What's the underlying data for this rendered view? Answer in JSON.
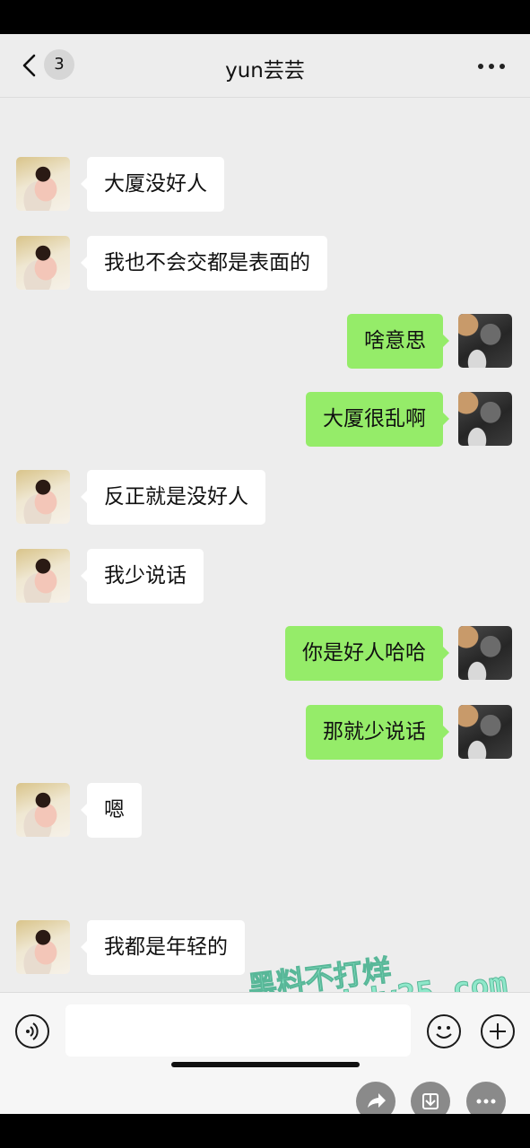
{
  "header": {
    "back_badge": "3",
    "title": "yun芸芸"
  },
  "messages": [
    {
      "side": "left",
      "text": "大厦没好人"
    },
    {
      "side": "left",
      "text": "我也不会交都是表面的"
    },
    {
      "side": "right",
      "text": "啥意思"
    },
    {
      "side": "right",
      "text": "大厦很乱啊"
    },
    {
      "side": "left",
      "text": "反正就是没好人"
    },
    {
      "side": "left",
      "text": "我少说话"
    },
    {
      "side": "right",
      "text": "你是好人哈哈"
    },
    {
      "side": "right",
      "text": "那就少说话"
    },
    {
      "side": "left",
      "text": "嗯"
    },
    {
      "side": "left",
      "text": "我都是年轻的"
    }
  ],
  "watermark": {
    "line1": "黑料不打烊",
    "line2": "https://cgbdy25.com"
  },
  "colors": {
    "incoming_bubble": "#ffffff",
    "outgoing_bubble": "#95ec69",
    "background": "#ededed"
  },
  "icons": [
    "back-icon",
    "more-icon",
    "voice-icon",
    "emoji-icon",
    "plus-icon",
    "share-icon",
    "download-icon",
    "more-options-icon"
  ]
}
